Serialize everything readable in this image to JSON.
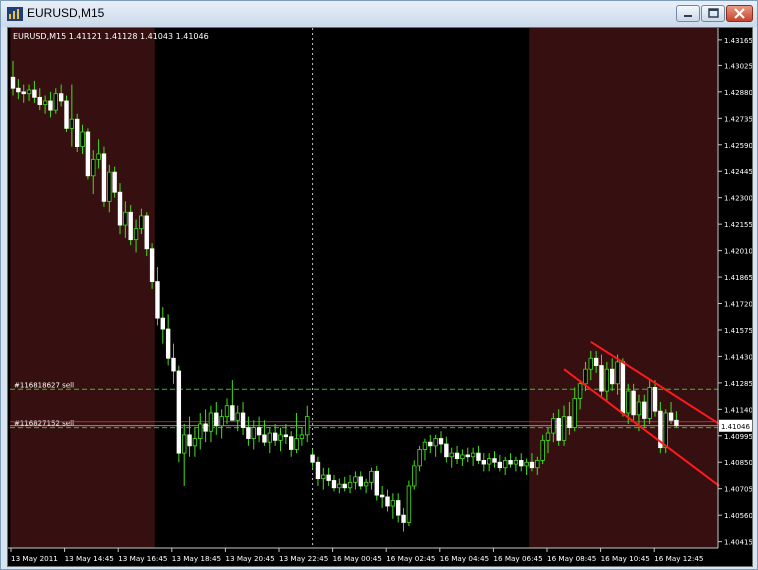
{
  "window": {
    "title": "EURUSD,M15",
    "buttons": {
      "minimize": "minimize-icon",
      "maximize": "maximize-icon",
      "close": "close-icon"
    }
  },
  "chart_data": {
    "type": "candlestick",
    "symbol_line": "EURUSD,M15  1.41121 1.41128 1.41043 1.41046",
    "current_price_label": "1.41046",
    "ylim": [
      1.4038,
      1.4323
    ],
    "y_ticks": [
      "1.43165",
      "1.43025",
      "1.42880",
      "1.42735",
      "1.42590",
      "1.42445",
      "1.42300",
      "1.42155",
      "1.42010",
      "1.41865",
      "1.41720",
      "1.41575",
      "1.41430",
      "1.41285",
      "1.41140",
      "1.40995",
      "1.40850",
      "1.40705",
      "1.40560",
      "1.40415"
    ],
    "x_ticks": [
      "13 May 2011",
      "13 May 14:45",
      "13 May 16:45",
      "13 May 18:45",
      "13 May 20:45",
      "13 May 22:45",
      "16 May 00:45",
      "16 May 02:45",
      "16 May 04:45",
      "16 May 06:45",
      "16 May 08:45",
      "16 May 10:45",
      "16 May 12:45"
    ],
    "orders": [
      {
        "label": "#116818627 sell",
        "price": 1.4125,
        "color": "#2fbf2f"
      },
      {
        "label": "#116827152 sell",
        "price": 1.4104,
        "color": "#2fbf2f"
      }
    ],
    "session_shading": [
      {
        "from_bar": 0,
        "to_bar": 26,
        "color": "#361010"
      },
      {
        "from_bar": 97,
        "to_bar": 132,
        "color": "#361010"
      }
    ],
    "period_separator_bar": 56,
    "up_color": "#f0f0c0",
    "down_color": "#ffffff",
    "wick_color": "#44e01a",
    "channel_color": "#ff1a1a",
    "candles": [
      [
        1.4296,
        1.4305,
        1.4286,
        1.429
      ],
      [
        1.429,
        1.4295,
        1.4284,
        1.4288
      ],
      [
        1.4288,
        1.4292,
        1.4282,
        1.4287
      ],
      [
        1.4287,
        1.4292,
        1.4283,
        1.4289
      ],
      [
        1.4289,
        1.4294,
        1.4282,
        1.4285
      ],
      [
        1.4285,
        1.429,
        1.4278,
        1.4281
      ],
      [
        1.4281,
        1.4286,
        1.4276,
        1.4283
      ],
      [
        1.4283,
        1.4288,
        1.4274,
        1.4278
      ],
      [
        1.4278,
        1.429,
        1.4276,
        1.4287
      ],
      [
        1.4287,
        1.4292,
        1.428,
        1.4283
      ],
      [
        1.4283,
        1.4286,
        1.4266,
        1.4268
      ],
      [
        1.4268,
        1.4292,
        1.4258,
        1.4273
      ],
      [
        1.4273,
        1.4276,
        1.4255,
        1.4258
      ],
      [
        1.4258,
        1.427,
        1.4254,
        1.4266
      ],
      [
        1.4266,
        1.4268,
        1.424,
        1.4242
      ],
      [
        1.4242,
        1.4256,
        1.4232,
        1.4251
      ],
      [
        1.4251,
        1.4262,
        1.4246,
        1.4254
      ],
      [
        1.4254,
        1.4258,
        1.4225,
        1.4228
      ],
      [
        1.4228,
        1.4248,
        1.4222,
        1.4244
      ],
      [
        1.4244,
        1.4247,
        1.423,
        1.4233
      ],
      [
        1.4233,
        1.4238,
        1.421,
        1.4215
      ],
      [
        1.4215,
        1.4228,
        1.4208,
        1.4222
      ],
      [
        1.4222,
        1.4226,
        1.4204,
        1.4207
      ],
      [
        1.4207,
        1.4218,
        1.42,
        1.4213
      ],
      [
        1.4213,
        1.4224,
        1.421,
        1.422
      ],
      [
        1.422,
        1.4222,
        1.4198,
        1.4202
      ],
      [
        1.4202,
        1.4205,
        1.418,
        1.4184
      ],
      [
        1.4184,
        1.4192,
        1.416,
        1.4164
      ],
      [
        1.4164,
        1.417,
        1.415,
        1.4158
      ],
      [
        1.4158,
        1.4166,
        1.4138,
        1.4142
      ],
      [
        1.4142,
        1.415,
        1.4128,
        1.4135
      ],
      [
        1.4135,
        1.4138,
        1.4085,
        1.409
      ],
      [
        1.409,
        1.4106,
        1.4072,
        1.41
      ],
      [
        1.41,
        1.411,
        1.4088,
        1.4094
      ],
      [
        1.4094,
        1.4104,
        1.4088,
        1.4098
      ],
      [
        1.4098,
        1.4112,
        1.4092,
        1.4106
      ],
      [
        1.4106,
        1.4114,
        1.4096,
        1.4102
      ],
      [
        1.4102,
        1.4116,
        1.4096,
        1.4112
      ],
      [
        1.4112,
        1.4118,
        1.41,
        1.4105
      ],
      [
        1.4105,
        1.4114,
        1.4098,
        1.411
      ],
      [
        1.411,
        1.412,
        1.4106,
        1.4116
      ],
      [
        1.4116,
        1.413,
        1.411,
        1.4108
      ],
      [
        1.4108,
        1.4116,
        1.4102,
        1.4112
      ],
      [
        1.4112,
        1.4118,
        1.41,
        1.4104
      ],
      [
        1.4104,
        1.411,
        1.4094,
        1.4098
      ],
      [
        1.4098,
        1.4108,
        1.4092,
        1.4104
      ],
      [
        1.4104,
        1.411,
        1.4096,
        1.41
      ],
      [
        1.41,
        1.4108,
        1.4094,
        1.4096
      ],
      [
        1.4096,
        1.4104,
        1.409,
        1.4101
      ],
      [
        1.4101,
        1.4106,
        1.4094,
        1.4097
      ],
      [
        1.4097,
        1.4104,
        1.4091,
        1.41
      ],
      [
        1.41,
        1.4106,
        1.4095,
        1.4099
      ],
      [
        1.4099,
        1.4102,
        1.4088,
        1.4092
      ],
      [
        1.4092,
        1.4112,
        1.409,
        1.4098
      ],
      [
        1.4098,
        1.4104,
        1.4094,
        1.41
      ],
      [
        1.41,
        1.4116,
        1.4096,
        1.411
      ],
      [
        1.4089,
        1.4092,
        1.4082,
        1.4085
      ],
      [
        1.4085,
        1.4088,
        1.4072,
        1.4076
      ],
      [
        1.4076,
        1.4082,
        1.407,
        1.4078
      ],
      [
        1.4078,
        1.4082,
        1.4072,
        1.4075
      ],
      [
        1.4075,
        1.4078,
        1.4069,
        1.4071
      ],
      [
        1.4071,
        1.4076,
        1.4068,
        1.4073
      ],
      [
        1.4073,
        1.4077,
        1.4069,
        1.4071
      ],
      [
        1.4071,
        1.4078,
        1.4068,
        1.4074
      ],
      [
        1.4074,
        1.408,
        1.407,
        1.4077
      ],
      [
        1.4077,
        1.408,
        1.407,
        1.4072
      ],
      [
        1.4072,
        1.4076,
        1.4068,
        1.4074
      ],
      [
        1.4074,
        1.4082,
        1.407,
        1.408
      ],
      [
        1.408,
        1.4083,
        1.4064,
        1.4067
      ],
      [
        1.4067,
        1.4072,
        1.406,
        1.4066
      ],
      [
        1.4066,
        1.407,
        1.4058,
        1.4061
      ],
      [
        1.4061,
        1.4068,
        1.4054,
        1.4064
      ],
      [
        1.4064,
        1.4068,
        1.4052,
        1.4056
      ],
      [
        1.4056,
        1.406,
        1.4047,
        1.4052
      ],
      [
        1.4052,
        1.4075,
        1.405,
        1.4072
      ],
      [
        1.4072,
        1.4086,
        1.407,
        1.4083
      ],
      [
        1.4083,
        1.4094,
        1.408,
        1.4092
      ],
      [
        1.4092,
        1.4098,
        1.4086,
        1.4096
      ],
      [
        1.4096,
        1.41,
        1.409,
        1.4094
      ],
      [
        1.4094,
        1.41,
        1.4088,
        1.4098
      ],
      [
        1.4098,
        1.4102,
        1.409,
        1.4095
      ],
      [
        1.4095,
        1.4099,
        1.4085,
        1.4088
      ],
      [
        1.4088,
        1.4093,
        1.4082,
        1.409
      ],
      [
        1.409,
        1.4094,
        1.4084,
        1.4087
      ],
      [
        1.4087,
        1.4092,
        1.4083,
        1.4089
      ],
      [
        1.4089,
        1.4093,
        1.4085,
        1.4088
      ],
      [
        1.4088,
        1.4093,
        1.4083,
        1.409
      ],
      [
        1.409,
        1.4094,
        1.4084,
        1.4086
      ],
      [
        1.4086,
        1.409,
        1.408,
        1.4084
      ],
      [
        1.4084,
        1.409,
        1.408,
        1.4087
      ],
      [
        1.4087,
        1.4091,
        1.4082,
        1.4085
      ],
      [
        1.4085,
        1.4089,
        1.408,
        1.4082
      ],
      [
        1.4082,
        1.4088,
        1.4078,
        1.4086
      ],
      [
        1.4086,
        1.409,
        1.4082,
        1.4084
      ],
      [
        1.4084,
        1.4088,
        1.408,
        1.4086
      ],
      [
        1.4086,
        1.409,
        1.408,
        1.4083
      ],
      [
        1.4083,
        1.4087,
        1.4078,
        1.4085
      ],
      [
        1.4085,
        1.409,
        1.408,
        1.4082
      ],
      [
        1.4082,
        1.4088,
        1.4078,
        1.4086
      ],
      [
        1.4086,
        1.41,
        1.4084,
        1.4097
      ],
      [
        1.4097,
        1.4104,
        1.409,
        1.4101
      ],
      [
        1.4101,
        1.4112,
        1.4096,
        1.4109
      ],
      [
        1.4109,
        1.4114,
        1.4094,
        1.4097
      ],
      [
        1.4097,
        1.4116,
        1.4094,
        1.411
      ],
      [
        1.411,
        1.4118,
        1.41,
        1.4104
      ],
      [
        1.4104,
        1.4126,
        1.4102,
        1.412
      ],
      [
        1.412,
        1.413,
        1.4114,
        1.4128
      ],
      [
        1.4128,
        1.414,
        1.4124,
        1.4136
      ],
      [
        1.4136,
        1.4146,
        1.413,
        1.4142
      ],
      [
        1.4142,
        1.4146,
        1.4134,
        1.4138
      ],
      [
        1.4138,
        1.4144,
        1.412,
        1.4124
      ],
      [
        1.4124,
        1.414,
        1.4118,
        1.4136
      ],
      [
        1.4136,
        1.4142,
        1.4124,
        1.4128
      ],
      [
        1.4128,
        1.4144,
        1.4122,
        1.414
      ],
      [
        1.414,
        1.4142,
        1.411,
        1.4112
      ],
      [
        1.4112,
        1.4128,
        1.4106,
        1.4124
      ],
      [
        1.4124,
        1.4128,
        1.4108,
        1.4111
      ],
      [
        1.4111,
        1.4122,
        1.4102,
        1.4118
      ],
      [
        1.4118,
        1.4122,
        1.4104,
        1.4109
      ],
      [
        1.4109,
        1.413,
        1.4106,
        1.4126
      ],
      [
        1.4126,
        1.413,
        1.411,
        1.4113
      ],
      [
        1.4113,
        1.4118,
        1.409,
        1.4093
      ],
      [
        1.4093,
        1.4114,
        1.409,
        1.4112
      ],
      [
        1.4112,
        1.4118,
        1.4106,
        1.4108
      ],
      [
        1.4108,
        1.4113,
        1.4104,
        1.4105
      ]
    ],
    "channel_lines": [
      {
        "bar1": 108,
        "price1": 1.4151,
        "bar2": 132,
        "price2": 1.4106
      },
      {
        "bar1": 103,
        "price1": 1.4136,
        "bar2": 132,
        "price2": 1.4072
      }
    ]
  }
}
